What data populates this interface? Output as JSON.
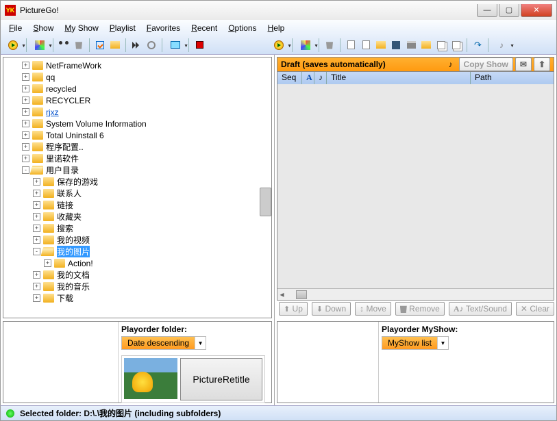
{
  "window": {
    "title": "PictureGo!"
  },
  "menu": [
    "File",
    "Show",
    "My Show",
    "Playlist",
    "Favorites",
    "Recent",
    "Options",
    "Help"
  ],
  "tree": {
    "root": [
      {
        "exp": "+",
        "label": "NetFrameWork"
      },
      {
        "exp": "+",
        "label": "qq"
      },
      {
        "exp": "+",
        "label": "recycled"
      },
      {
        "exp": "+",
        "label": "RECYCLER"
      },
      {
        "exp": "+",
        "label": "rjxz",
        "link": true
      },
      {
        "exp": "+",
        "label": "System Volume Information"
      },
      {
        "exp": "+",
        "label": "Total Uninstall 6"
      },
      {
        "exp": "+",
        "label": "程序配置.."
      },
      {
        "exp": "+",
        "label": "里诺软件"
      },
      {
        "exp": "-",
        "label": "用户目录",
        "open": true,
        "children": [
          {
            "exp": "+",
            "label": "保存的游戏"
          },
          {
            "exp": "+",
            "label": "联系人"
          },
          {
            "exp": "+",
            "label": "链接"
          },
          {
            "exp": "+",
            "label": "收藏夹"
          },
          {
            "exp": "+",
            "label": "搜索"
          },
          {
            "exp": "+",
            "label": "我的视频"
          },
          {
            "exp": "-",
            "label": "我的图片",
            "open": true,
            "sel": true,
            "children": [
              {
                "exp": "+",
                "label": "Action!"
              }
            ]
          },
          {
            "exp": "+",
            "label": "我的文档"
          },
          {
            "exp": "+",
            "label": "我的音乐"
          },
          {
            "exp": "+",
            "label": "下载"
          }
        ]
      }
    ]
  },
  "playorder_folder": {
    "label": "Playorder folder:",
    "value": "Date descending"
  },
  "picture_retitle": "PictureRetitle",
  "draft_header": "Draft (saves automatically)",
  "copy_show": "Copy Show",
  "grid_headers": {
    "seq": "Seq",
    "title": "Title",
    "path": "Path"
  },
  "ops": {
    "up": "Up",
    "down": "Down",
    "move": "Move",
    "remove": "Remove",
    "textsound": "Text/Sound",
    "clear": "Clear"
  },
  "playorder_myshow": {
    "label": "Playorder MyShow:",
    "value": "MyShow list"
  },
  "status": {
    "prefix": "Selected folder: ",
    "path": "D:\\.\\我的图片  (including subfolders)"
  }
}
